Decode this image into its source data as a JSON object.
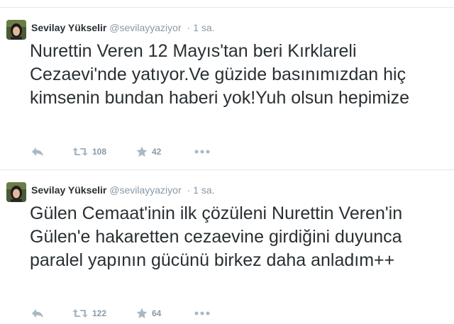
{
  "tweets": [
    {
      "fullname": "Sevilay Yükselir",
      "username": "@sevilayyaziyor",
      "separator": "·",
      "time": "1 sa.",
      "text": "Nurettin Veren 12 Mayıs'tan beri Kırklareli Cezaevi'nde yatıyor.Ve güzide basınımızdan hiç kimsenin bundan haberi yok!Yuh olsun hepimize",
      "retweets": "108",
      "favorites": "42"
    },
    {
      "fullname": "Sevilay Yükselir",
      "username": "@sevilayyaziyor",
      "separator": "·",
      "time": "1 sa.",
      "text": "Gülen Cemaat'inin ilk çözüleni Nurettin Veren'in Gülen'e hakaretten cezaevine girdiğini duyunca paralel yapının gücünü birkez daha anladım++",
      "retweets": "122",
      "favorites": "64"
    }
  ],
  "icons": {
    "reply": "reply-icon",
    "retweet": "retweet-icon",
    "favorite": "star-icon",
    "more": "more-dots-icon"
  },
  "colors": {
    "text": "#292f33",
    "secondary": "#8899a6",
    "icon": "#aab8c2",
    "border": "#e1e8ed"
  }
}
